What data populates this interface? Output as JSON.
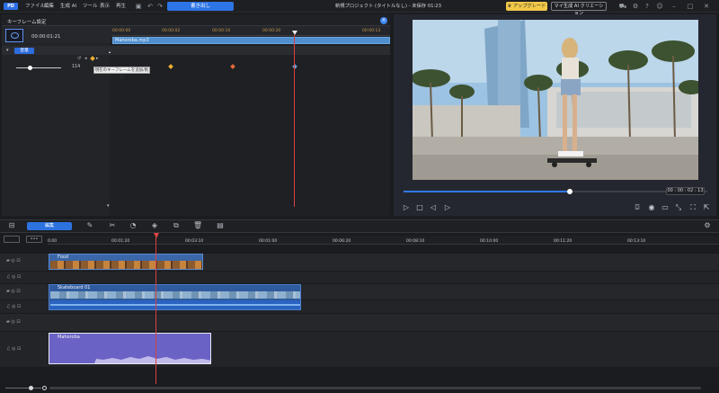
{
  "app": {
    "logo": "PD",
    "menu": [
      "ファイル",
      "編集",
      "生成 AI",
      "ツール",
      "表示",
      "再生"
    ],
    "export_label": "書き出し",
    "window_title": "新規プロジェクト (タイトルなし) - 未保存 01:23",
    "upgrade_label": "アップグレード",
    "ai_label": "マイ生成 AI クリエーション"
  },
  "keyframe_panel": {
    "title": "キーフレーム設定",
    "timecode": "00:00:01:21",
    "clip_name": "Mahoroba.mp3",
    "ruler_ticks": [
      "00:00:00",
      "00:00:02",
      "00:00:10",
      "00:00:20",
      "00:00:13"
    ],
    "section_label": "音量",
    "volume_value": "114",
    "tooltip": "現在のキーフレームを追加/削除"
  },
  "preview": {
    "timecode": "00 : 00 : 02 : 13",
    "progress": 0.55
  },
  "toolbar": {
    "edit_label": "編集"
  },
  "timeline": {
    "ruler_ticks": [
      "0:00",
      "00:01:20",
      "00:03:10",
      "00:01:00",
      "00:06:20",
      "00:08:10",
      "00:10:00",
      "00:11:20",
      "00:13:10"
    ],
    "tracks": [
      {
        "kind": "video",
        "clip": "Food"
      },
      {
        "kind": "audio",
        "clip": ""
      },
      {
        "kind": "video",
        "clip": "Skateboard 01"
      },
      {
        "kind": "audio",
        "clip": ""
      },
      {
        "kind": "video",
        "clip": ""
      },
      {
        "kind": "audio",
        "clip": "Mahoroba"
      }
    ]
  },
  "colors": {
    "accent": "#2d75e6",
    "playhead": "#d94040",
    "upgrade": "#f2c849",
    "audio_clip": "#6a62c4"
  }
}
